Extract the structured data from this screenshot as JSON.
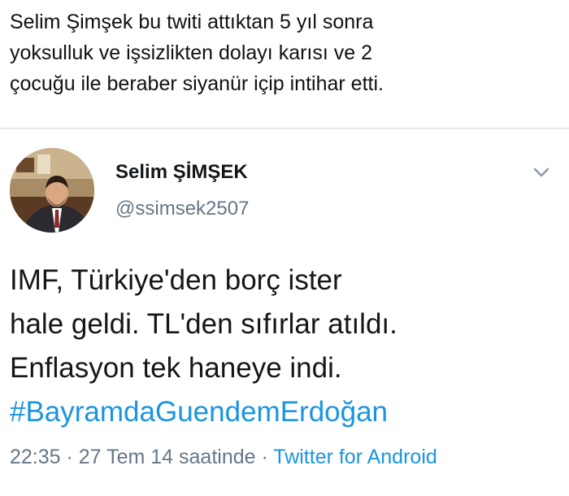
{
  "caption": {
    "line1": "Selim Şimşek bu twiti attıktan 5 yıl sonra",
    "line2": "yoksulluk ve işsizlikten dolayı karısı ve 2",
    "line3": "çocuğu ile beraber siyanür içip intihar etti."
  },
  "tweet": {
    "display_name": "Selim ŞİMŞEK",
    "handle": "@ssimsek2507",
    "body_lines": [
      "IMF, Türkiye'den borç ister",
      "hale geldi. TL'den sıfırlar atıldı.",
      "Enflasyon tek haneye indi."
    ],
    "hashtag": "#BayramdaGuendemErdoğan",
    "time": "22:35",
    "separator": " · ",
    "date": "27 Tem 14 saatinde",
    "source": "Twitter for Android",
    "menu_icon": "chevron-down-icon"
  },
  "colors": {
    "link": "#1b95e0",
    "secondary_text": "#657786",
    "primary_text": "#14171a",
    "divider": "#e6ecf0"
  }
}
